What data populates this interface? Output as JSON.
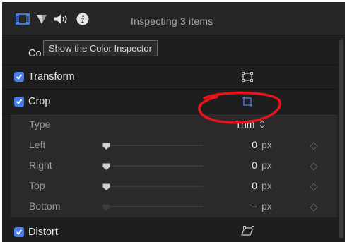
{
  "header": {
    "title": "Inspecting 3 items",
    "tabs": [
      {
        "name": "video-inspector-icon",
        "active": true
      },
      {
        "name": "color-inspector-icon",
        "active": false
      },
      {
        "name": "audio-inspector-icon",
        "active": false
      },
      {
        "name": "info-inspector-icon",
        "active": false
      }
    ]
  },
  "color_row": {
    "label_partial": "Co"
  },
  "tooltip": {
    "text": "Show the Color Inspector"
  },
  "sections": [
    {
      "label": "Transform",
      "checked": true,
      "icon": "transform-onscreen-control-icon"
    },
    {
      "label": "Crop",
      "checked": true,
      "icon": "crop-onscreen-control-icon"
    },
    {
      "label": "Distort",
      "checked": true,
      "icon": "distort-onscreen-control-icon"
    }
  ],
  "crop": {
    "type": {
      "label": "Type",
      "value": "Trim"
    },
    "params": [
      {
        "label": "Left",
        "value": "0",
        "unit": "px",
        "has_slider": true
      },
      {
        "label": "Right",
        "value": "0",
        "unit": "px",
        "has_slider": true
      },
      {
        "label": "Top",
        "value": "0",
        "unit": "px",
        "has_slider": true
      },
      {
        "label": "Bottom",
        "value": "--",
        "unit": "px",
        "has_slider": true
      }
    ]
  },
  "colors": {
    "accent": "#4a7ff0",
    "annotation": "#e8141b",
    "panel": "#1e1e1e",
    "param_block": "#2a2a2a"
  }
}
